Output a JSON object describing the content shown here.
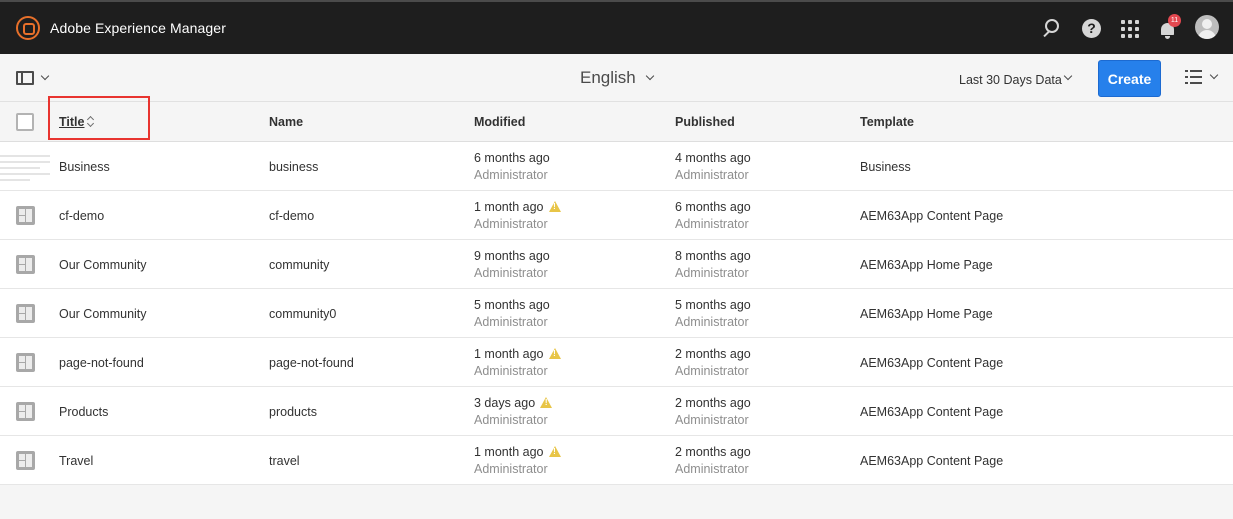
{
  "shell": {
    "app_title": "Adobe Experience Manager",
    "notification_count": "11",
    "icons": [
      "adobe-logo-icon",
      "search-icon",
      "help-icon",
      "apps-grid-icon",
      "bell-icon",
      "user-avatar-icon"
    ]
  },
  "actionbar": {
    "language": "English",
    "period": "Last 30 Days Data",
    "create_label": "Create"
  },
  "table": {
    "headers": {
      "title": "Title",
      "name": "Name",
      "modified": "Modified",
      "published": "Published",
      "template": "Template"
    },
    "rows": [
      {
        "icon": "thumbnail",
        "title": "Business",
        "name": "business",
        "modified": "6 months ago",
        "modified_by": "Administrator",
        "modified_warning": false,
        "published": "4 months ago",
        "published_by": "Administrator",
        "template": "Business"
      },
      {
        "icon": "page-icon",
        "title": "cf-demo",
        "name": "cf-demo",
        "modified": "1 month ago",
        "modified_by": "Administrator",
        "modified_warning": true,
        "published": "6 months ago",
        "published_by": "Administrator",
        "template": "AEM63App Content Page"
      },
      {
        "icon": "page-icon",
        "title": "Our Community",
        "name": "community",
        "modified": "9 months ago",
        "modified_by": "Administrator",
        "modified_warning": false,
        "published": "8 months ago",
        "published_by": "Administrator",
        "template": "AEM63App Home Page"
      },
      {
        "icon": "page-icon",
        "title": "Our Community",
        "name": "community0",
        "modified": "5 months ago",
        "modified_by": "Administrator",
        "modified_warning": false,
        "published": "5 months ago",
        "published_by": "Administrator",
        "template": "AEM63App Home Page"
      },
      {
        "icon": "page-icon",
        "title": "page-not-found",
        "name": "page-not-found",
        "modified": "1 month ago",
        "modified_by": "Administrator",
        "modified_warning": true,
        "published": "2 months ago",
        "published_by": "Administrator",
        "template": "AEM63App Content Page"
      },
      {
        "icon": "page-icon",
        "title": "Products",
        "name": "products",
        "modified": "3 days ago",
        "modified_by": "Administrator",
        "modified_warning": true,
        "published": "2 months ago",
        "published_by": "Administrator",
        "template": "AEM63App Content Page"
      },
      {
        "icon": "page-icon",
        "title": "Travel",
        "name": "travel",
        "modified": "1 month ago",
        "modified_by": "Administrator",
        "modified_warning": true,
        "published": "2 months ago",
        "published_by": "Administrator",
        "template": "AEM63App Content Page"
      }
    ]
  },
  "colors": {
    "shell_bg": "#1e1e1e",
    "brand_logo": "#e8702a",
    "create_button": "#2680eb",
    "notification_badge": "#e34850",
    "warning": "#e8c547",
    "highlight_annotation": "#e8342f"
  }
}
